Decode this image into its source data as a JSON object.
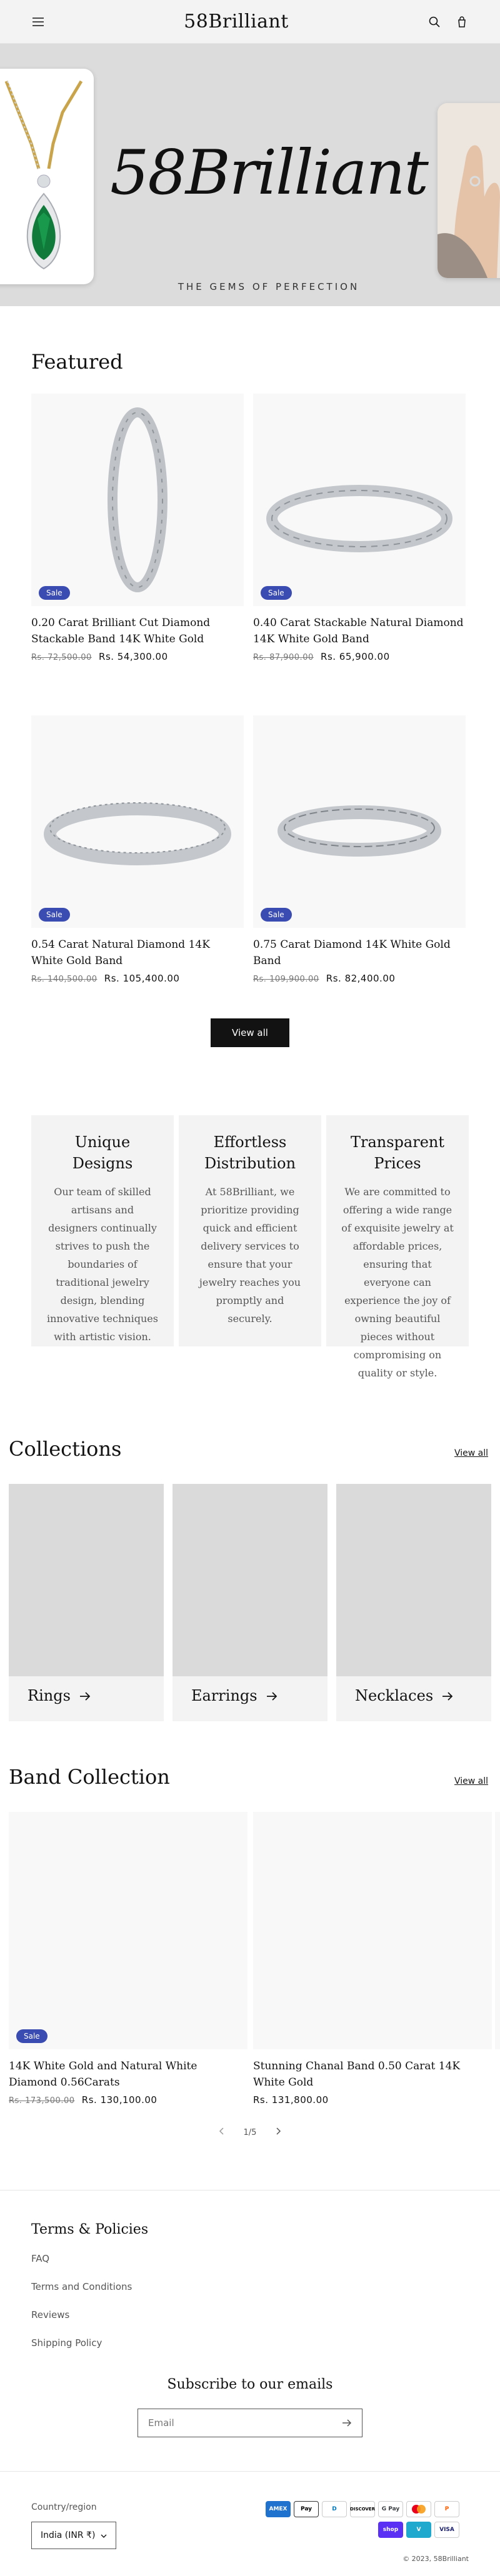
{
  "header": {
    "logo": "58Brilliant"
  },
  "hero": {
    "title": "58Brilliant",
    "tagline": "THE GEMS OF PERFECTION"
  },
  "featured": {
    "title": "Featured",
    "products": [
      {
        "title": "0.20 Carat Brilliant Cut Diamond Stackable Band 14K White Gold",
        "old_price": "Rs. 72,500.00",
        "price": "Rs. 54,300.00",
        "badge": "Sale"
      },
      {
        "title": "0.40 Carat Stackable Natural Diamond 14K White Gold Band",
        "old_price": "Rs. 87,900.00",
        "price": "Rs. 65,900.00",
        "badge": "Sale"
      },
      {
        "title": "0.54 Carat Natural Diamond 14K White Gold Band",
        "old_price": "Rs. 140,500.00",
        "price": "Rs. 105,400.00",
        "badge": "Sale"
      },
      {
        "title": "0.75 Carat Diamond 14K White Gold Band",
        "old_price": "Rs. 109,900.00",
        "price": "Rs. 82,400.00",
        "badge": "Sale"
      }
    ],
    "view_all": "View all"
  },
  "values": [
    {
      "title": "Unique Designs",
      "text": "Our team of skilled artisans and designers continually strives to push the boundaries of traditional jewelry design, blending innovative techniques with artistic vision."
    },
    {
      "title": "Effortless Distribution",
      "text": "At 58Brilliant, we prioritize providing quick and efficient delivery services to ensure that your jewelry reaches you promptly and securely."
    },
    {
      "title": "Transparent Prices",
      "text": "We are committed to offering a wide range of exquisite jewelry at affordable prices, ensuring that everyone can experience the joy of owning beautiful pieces without compromising on quality or style."
    }
  ],
  "collections": {
    "title": "Collections",
    "view_all": "View all",
    "items": [
      {
        "label": "Rings"
      },
      {
        "label": "Earrings"
      },
      {
        "label": "Necklaces"
      }
    ]
  },
  "band": {
    "title": "Band Collection",
    "view_all": "View all",
    "products": [
      {
        "title": "14K White Gold and Natural White Diamond 0.56Carats",
        "old_price": "Rs. 173,500.00",
        "price": "Rs. 130,100.00",
        "badge": "Sale"
      },
      {
        "title": "Stunning Chanal Band 0.50 Carat 14K White Gold",
        "old_price": "",
        "price": "Rs. 131,800.00",
        "badge": ""
      }
    ],
    "pager": "1/5"
  },
  "footer": {
    "policies_title": "Terms & Policies",
    "links": [
      "FAQ",
      "Terms and Conditions",
      "Reviews",
      "Shipping Policy"
    ],
    "subscribe_title": "Subscribe to our emails",
    "email_placeholder": "Email",
    "region_label": "Country/region",
    "region_value": "India (INR ₹)",
    "payments": [
      "AMEX",
      "Pay",
      "D",
      "DISCOVER",
      "G Pay",
      "MC",
      "shop",
      "V",
      "VISA"
    ],
    "copyright": "© 2023, 58Brilliant"
  },
  "colors": {
    "sale_badge": "#3a4bb1",
    "hero_bg": "#dcdcdc",
    "dark_button": "#121212"
  }
}
